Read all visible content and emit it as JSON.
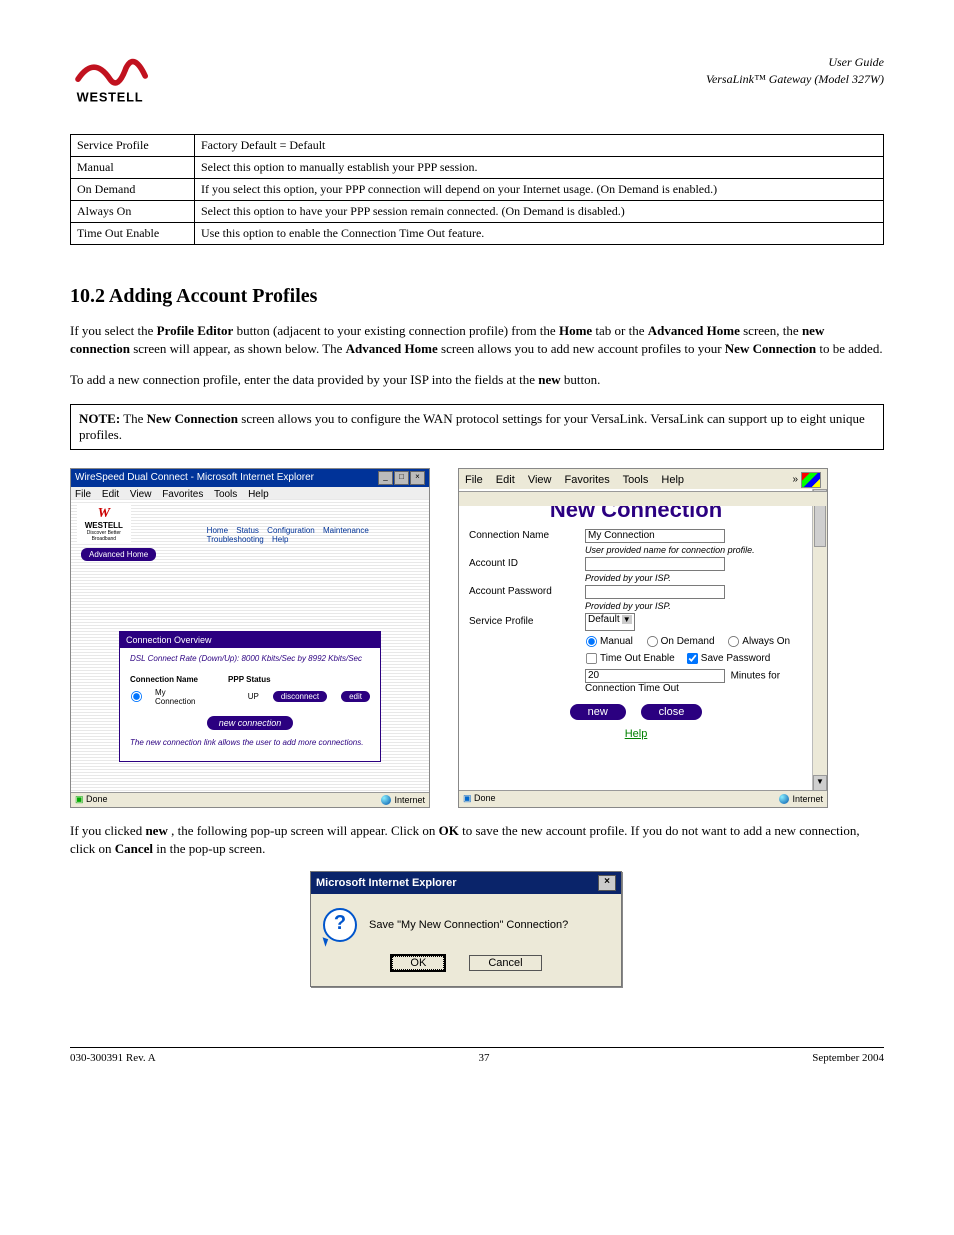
{
  "header": {
    "logo_text": "WESTELL",
    "right_line1": "User Guide",
    "right_line2": "VersaLink™ Gateway (Model 327W)"
  },
  "table": {
    "rows": [
      [
        "Service Profile",
        "Factory Default = Default"
      ],
      [
        "Manual",
        "Select this option to manually establish your PPP session."
      ],
      [
        "On Demand",
        "If you select this option, your PPP connection will depend on your Internet usage. (On Demand is enabled.)"
      ],
      [
        "Always On",
        "Select this option to have your PPP session remain connected. (On Demand is disabled.)"
      ],
      [
        "Time Out Enable",
        "Use this option to enable the Connection Time Out feature."
      ]
    ]
  },
  "section": {
    "heading": "10.2 Adding Account Profiles",
    "para1_pre": "If you select the ",
    "profile_editor": "Profile Editor",
    "para1_mid1": " button (adjacent to your existing connection profile) from the ",
    "home_bold": "Home",
    "para1_mid2": " tab or the ",
    "adv_home_bold": "Advanced Home",
    "para1_mid3": " screen, the ",
    "new_connection_bold": "new connection",
    "para1_mid4": " screen will appear, as shown below. The ",
    "adv_home_bold2": "Advanced Home",
    "para1_mid5": " screen allows you to add new account profiles to your ",
    "new_connection_bold2": "New Connection",
    "para1_end": " to be added.",
    "para2_pre": "To add a new connection profile, enter the data provided by your ISP into the fields at the ",
    "new_bold": "new",
    "para2_end": " button."
  },
  "note": {
    "label": "NOTE:",
    "text_pre": " The ",
    "nc_bold": "New Connection",
    "text_post": " screen allows you to configure the WAN protocol settings for your VersaLink. VersaLink can support up to eight unique profiles."
  },
  "screen_left": {
    "title": "WireSpeed Dual Connect - Microsoft Internet Explorer",
    "menu": [
      "File",
      "Edit",
      "View",
      "Favorites",
      "Tools",
      "Help"
    ],
    "logo_brand": "WESTELL",
    "logo_tag": "Discover Better Broadband",
    "nav": [
      "Home",
      "Status",
      "Configuration",
      "Maintenance",
      "Troubleshooting",
      "Help"
    ],
    "adv_btn": "Advanced Home",
    "panel_title": "Connection Overview",
    "rate_line": "DSL Connect Rate (Down/Up):   8000 Kbits/Sec by 8992 Kbits/Sec",
    "col1": "Connection Name",
    "col2": "PPP Status",
    "row_name": "My Connection",
    "row_status": "UP",
    "btn_disconnect": "disconnect",
    "btn_edit": "edit",
    "btn_newconn": "new connection",
    "hint": "The new connection link allows the user to add more connections.",
    "status_left": "Done",
    "status_right": "Internet"
  },
  "screen_right": {
    "menu": [
      "File",
      "Edit",
      "View",
      "Favorites",
      "Tools",
      "Help"
    ],
    "title": "New Connection",
    "f_conn_name_lbl": "Connection Name",
    "f_conn_name_val": "My Connection",
    "f_conn_name_hint": "User provided name for connection profile.",
    "f_acct_id_lbl": "Account ID",
    "f_acct_id_hint": "Provided by your ISP.",
    "f_pwd_lbl": "Account Password",
    "f_pwd_hint": "Provided by your ISP.",
    "f_profile_lbl": "Service Profile",
    "f_profile_val": "Default",
    "r_manual": "Manual",
    "r_ondemand": "On Demand",
    "r_always": "Always On",
    "chk_timeout": "Time Out Enable",
    "chk_savepwd": "Save Password",
    "timeout_val": "20",
    "timeout_suffix": "Minutes for Connection Time Out",
    "btn_new": "new",
    "btn_close": "close",
    "help": "Help",
    "status_left": "Done",
    "status_right": "Internet"
  },
  "after_screens": {
    "pre": "If you clicked ",
    "new_bold": "new",
    "mid1": ", the following pop-up screen will appear. Click on ",
    "ok_bold": "OK",
    "mid2": " to save the new account profile. If you do not want to add a new connection, click on ",
    "cancel_bold": "Cancel",
    "end": " in the pop-up screen."
  },
  "dialog": {
    "title": "Microsoft Internet Explorer",
    "message": "Save \"My New Connection\" Connection?",
    "ok": "OK",
    "cancel": "Cancel"
  },
  "footer": {
    "left": "030-300391 Rev. A",
    "center": "37",
    "right": "September 2004"
  }
}
